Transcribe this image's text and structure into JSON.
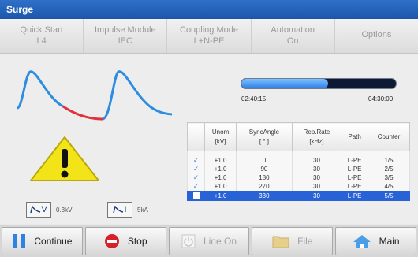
{
  "window": {
    "title": "Surge"
  },
  "tabs": [
    {
      "label": "Quick Start",
      "value": "L4"
    },
    {
      "label": "Impulse Module",
      "value": "IEC"
    },
    {
      "label": "Coupling Mode",
      "value": "L+N-PE"
    },
    {
      "label": "Automation",
      "value": "On"
    },
    {
      "label": "Options",
      "value": ""
    }
  ],
  "progress": {
    "fraction": 0.56,
    "elapsed": "02:40:15",
    "total": "04:30:00",
    "color": "#2f7ee6"
  },
  "meters": {
    "voltage": {
      "icon": "voltage-waveform-icon",
      "symbol": "V",
      "value": "0.3kV"
    },
    "current": {
      "icon": "current-waveform-icon",
      "symbol": "I",
      "value": "5kA"
    }
  },
  "table": {
    "headers": [
      {
        "line1": "Unom",
        "line2": "[kV]"
      },
      {
        "line1": "SyncAngle",
        "line2": "[ ° ]"
      },
      {
        "line1": "Rep.Rate",
        "line2": "[kHz]"
      },
      {
        "line1": "Path",
        "line2": ""
      },
      {
        "line1": "Counter",
        "line2": ""
      }
    ],
    "rows": [
      {
        "done": true,
        "unom": "+1.0",
        "angle": "0",
        "rate": "30",
        "path": "L-PE",
        "counter": "1/5"
      },
      {
        "done": true,
        "unom": "+1.0",
        "angle": "90",
        "rate": "30",
        "path": "L-PE",
        "counter": "2/5"
      },
      {
        "done": true,
        "unom": "+1.0",
        "angle": "180",
        "rate": "30",
        "path": "L-PE",
        "counter": "3/5"
      },
      {
        "done": true,
        "unom": "+1.0",
        "angle": "270",
        "rate": "30",
        "path": "L-PE",
        "counter": "4/5"
      },
      {
        "done": false,
        "unom": "+1.0",
        "angle": "330",
        "rate": "30",
        "path": "L-PE",
        "counter": "5/5"
      }
    ],
    "selected_color": "#2762d6"
  },
  "bottom_buttons": [
    {
      "label": "Continue",
      "icon": "pause-icon",
      "enabled": true
    },
    {
      "label": "Stop",
      "icon": "stop-icon",
      "enabled": true
    },
    {
      "label": "Line On",
      "icon": "line-on-icon",
      "enabled": false
    },
    {
      "label": "File",
      "icon": "folder-icon",
      "enabled": false
    },
    {
      "label": "Main",
      "icon": "home-icon",
      "enabled": true
    }
  ],
  "colors": {
    "accent": "#1c56ab",
    "wave": "#2e8de0",
    "wave_tail": "#e0323c",
    "warning": "#f3e41a"
  }
}
